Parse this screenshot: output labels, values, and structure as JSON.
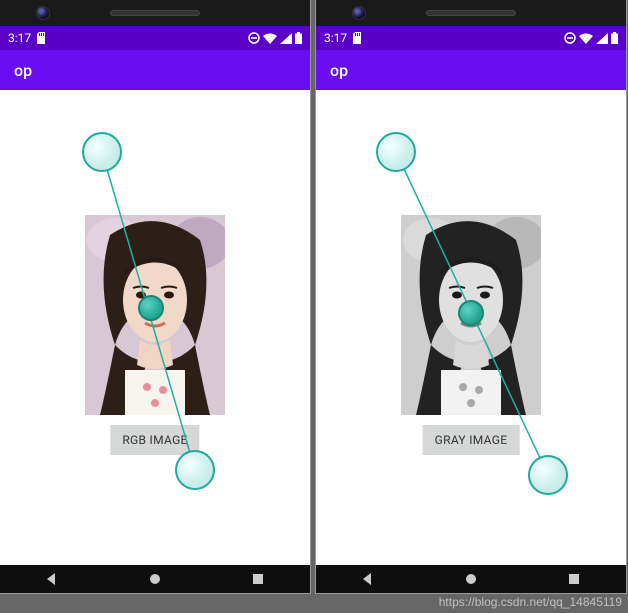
{
  "accent_color": "#6a0df0",
  "status_bar_color": "#5b01c7",
  "left": {
    "status": {
      "time": "3:17"
    },
    "app_title": "op",
    "button_label": "RGB IMAGE",
    "image_mode": "rgb"
  },
  "right": {
    "status": {
      "time": "3:17"
    },
    "app_title": "op",
    "button_label": "GRAY IMAGE",
    "image_mode": "gray"
  },
  "overlay": {
    "line_color": "#20b0a0",
    "circles": [
      "top",
      "mid",
      "bottom"
    ]
  },
  "watermark": "https://blog.csdn.net/qq_14845119"
}
